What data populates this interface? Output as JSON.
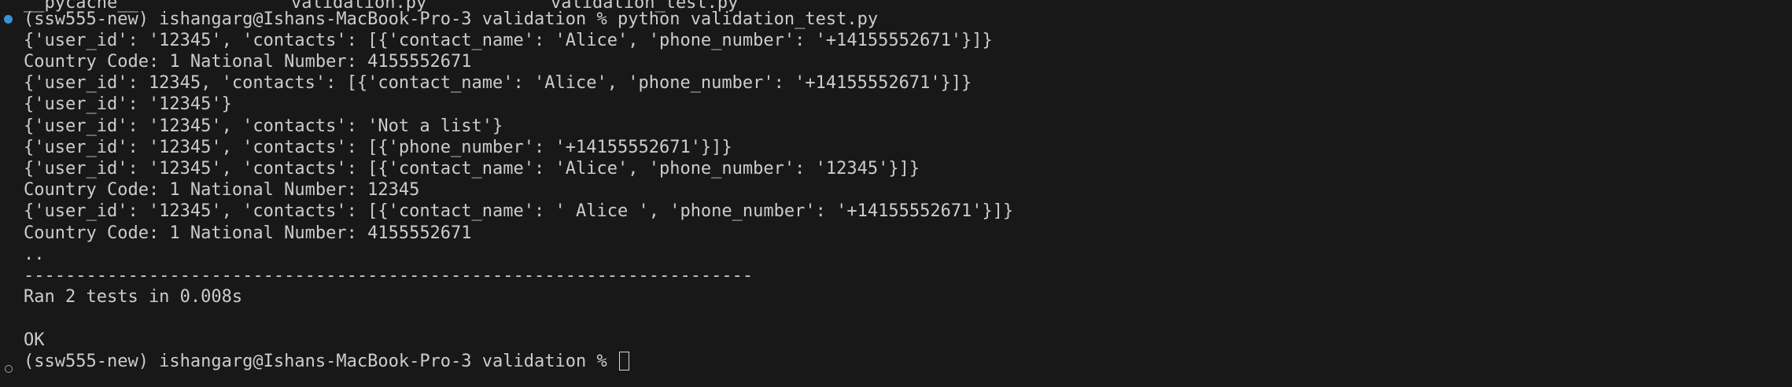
{
  "terminal": {
    "partial_top": [
      "__pycache__",
      "validation.py",
      "validation_test.py"
    ],
    "lines": [
      "(ssw555-new) ishangarg@Ishans-MacBook-Pro-3 validation % python validation_test.py",
      "{'user_id': '12345', 'contacts': [{'contact_name': 'Alice', 'phone_number': '+14155552671'}]}",
      "Country Code: 1 National Number: 4155552671",
      "{'user_id': 12345, 'contacts': [{'contact_name': 'Alice', 'phone_number': '+14155552671'}]}",
      "{'user_id': '12345'}",
      "{'user_id': '12345', 'contacts': 'Not a list'}",
      "{'user_id': '12345', 'contacts': [{'phone_number': '+14155552671'}]}",
      "{'user_id': '12345', 'contacts': [{'contact_name': 'Alice', 'phone_number': '12345'}]}",
      "Country Code: 1 National Number: 12345",
      "{'user_id': '12345', 'contacts': [{'contact_name': ' Alice ', 'phone_number': '+14155552671'}]}",
      "Country Code: 1 National Number: 4155552671",
      "..",
      "----------------------------------------------------------------------",
      "Ran 2 tests in 0.008s",
      "",
      "OK",
      "(ssw555-new) ishangarg@Ishans-MacBook-Pro-3 validation % "
    ],
    "colors": {
      "background": "#181818",
      "text": "#cccccc",
      "success_marker": "#3794d6"
    }
  }
}
